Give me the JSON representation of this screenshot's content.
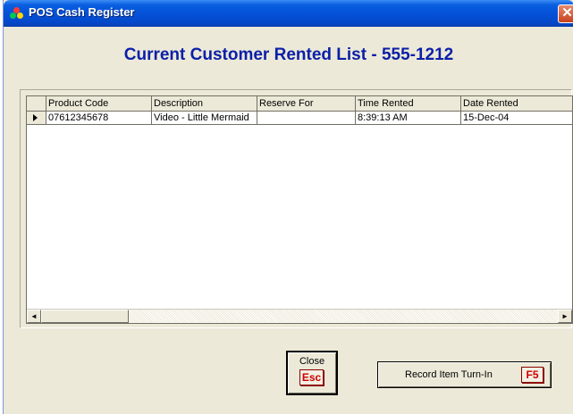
{
  "window": {
    "title": "POS Cash Register",
    "close_glyph": "✕"
  },
  "heading": "Current Customer Rented List - 555-1212",
  "grid": {
    "columns": [
      "Product Code",
      "Description",
      "Reserve For",
      "Time Rented",
      "Date Rented"
    ],
    "rows": [
      {
        "product_code": "07612345678",
        "description": "Video - Little Mermaid",
        "reserve_for": "",
        "time_rented": "8:39:13 AM",
        "date_rented": "15-Dec-04"
      }
    ],
    "scroll_left": "◄",
    "scroll_right": "►"
  },
  "buttons": {
    "close": {
      "label": "Close",
      "key": "Esc"
    },
    "turnin": {
      "label": "Record Item Turn-In",
      "key": "F5"
    }
  },
  "colors": {
    "heading": "#0a1fa8",
    "titlebar": "#0451d8",
    "key_text": "#cc0000"
  }
}
